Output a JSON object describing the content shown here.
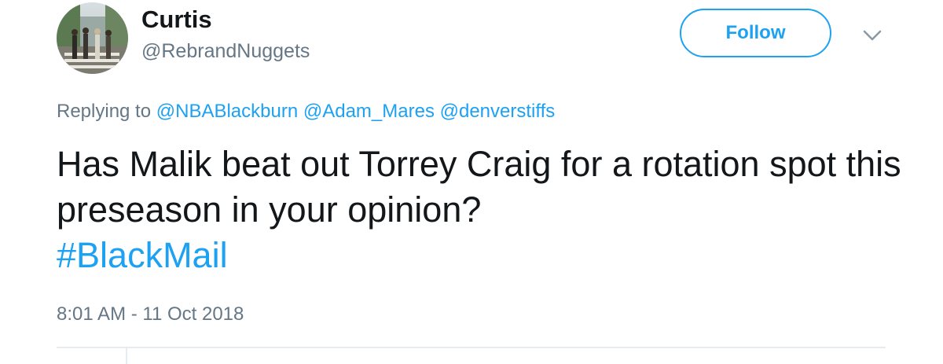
{
  "user": {
    "display_name": "Curtis",
    "handle": "@RebrandNuggets",
    "avatar_icon": "abbey-road-photo"
  },
  "actions": {
    "follow_label": "Follow",
    "more_icon": "chevron-down-icon"
  },
  "reply": {
    "prefix": "Replying to",
    "mentions": [
      "@NBABlackburn",
      "@Adam_Mares",
      "@denverstiffs"
    ]
  },
  "tweet": {
    "text": "Has Malik beat out Torrey Craig for a rotation spot this preseason in your opinion?",
    "hashtag": "#BlackMail"
  },
  "meta": {
    "timestamp": "8:01 AM - 11 Oct 2018"
  },
  "colors": {
    "accent": "#1da1f2",
    "text_primary": "#14171a",
    "text_secondary": "#657786",
    "divider": "#e6ecf0"
  }
}
